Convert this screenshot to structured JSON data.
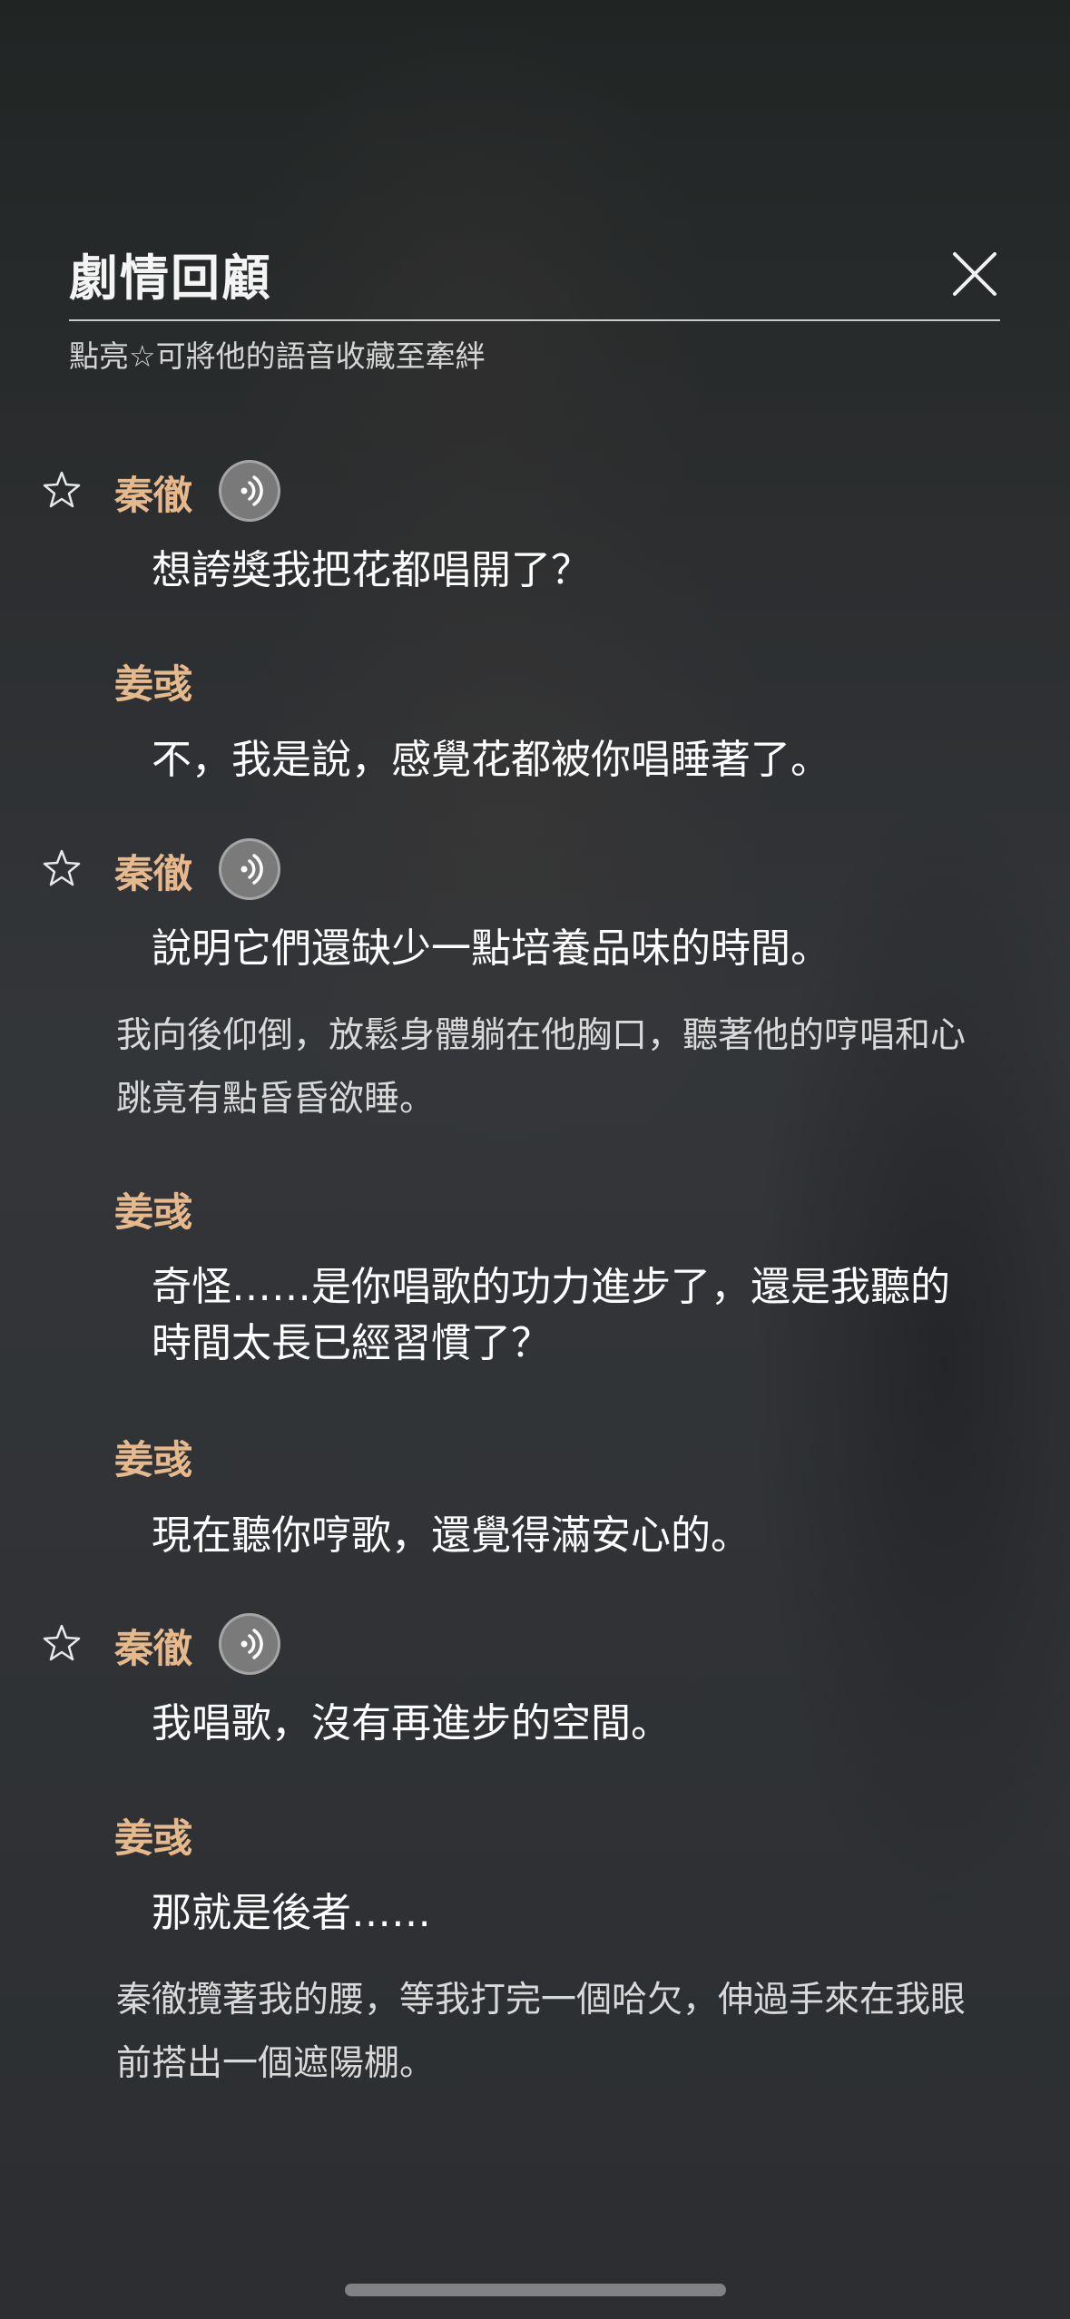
{
  "header": {
    "title": "劇情回顧",
    "subtitle": "點亮☆可將他的語音收藏至牽絆"
  },
  "dialogue": [
    {
      "speaker": "秦徹",
      "text": "想誇獎我把花都唱開了？"
    },
    {
      "speaker": "姜彧",
      "text": "不，我是說，感覺花都被你唱睡著了。"
    },
    {
      "speaker": "秦徹",
      "text": "說明它們還缺少一點培養品味的時間。"
    },
    {
      "narration": "我向後仰倒，放鬆身體躺在他胸口，聽著他的哼唱和心跳竟有點昏昏欲睡。"
    },
    {
      "speaker": "姜彧",
      "text": "奇怪……是你唱歌的功力進步了，還是我聽的時間太長已經習慣了？"
    },
    {
      "speaker": "姜彧",
      "text": "現在聽你哼歌，還覺得滿安心的。"
    },
    {
      "speaker": "秦徹",
      "text": "我唱歌，沒有再進步的空間。"
    },
    {
      "speaker": "姜彧",
      "text": "那就是後者……"
    },
    {
      "narration": "秦徹攬著我的腰，等我打完一個哈欠，伸過手來在我眼前搭出一個遮陽棚。"
    }
  ],
  "icons": {
    "close": "close-icon",
    "star": "star-outline-icon",
    "voice": "voice-play-icon"
  },
  "colors": {
    "speaker_name": "#e6b98d",
    "line_text": "#ffffff",
    "narration_text": "#d9d9d9"
  }
}
